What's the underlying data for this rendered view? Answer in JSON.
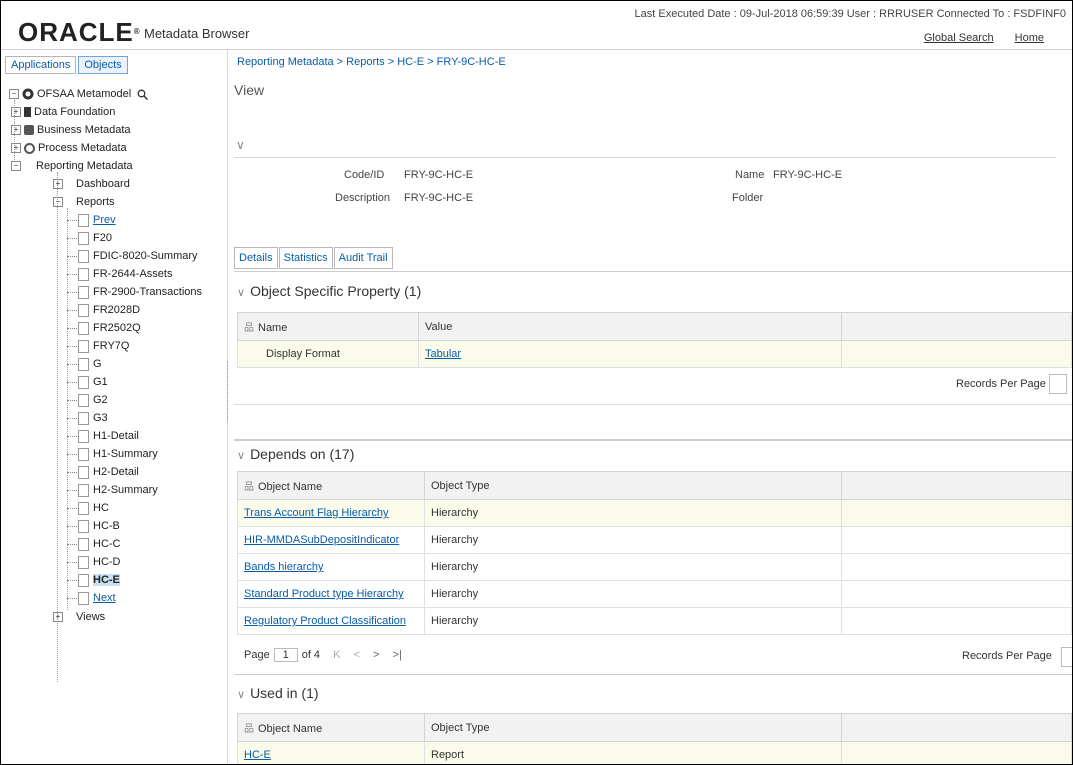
{
  "header": {
    "logo": "ORACLE",
    "app_title": "Metadata Browser",
    "info": "Last Executed Date : 09-Jul-2018 06:59:39   User : RRRUSER   Connected To : FSDFINF0",
    "links": [
      "Global Search",
      "Home"
    ]
  },
  "left_tabs": [
    "Applications",
    "Objects"
  ],
  "tree": {
    "root": "OFSAA Metamodel",
    "top_nodes": [
      "Data Foundation",
      "Business Metadata",
      "Process Metadata",
      "Reporting Metadata"
    ],
    "reporting_children": [
      "Dashboard",
      "Reports",
      "Views"
    ],
    "reports": [
      "Prev",
      "F20",
      "FDIC-8020-Summary",
      "FR-2644-Assets",
      "FR-2900-Transactions",
      "FR2028D",
      "FR2502Q",
      "FRY7Q",
      "G",
      "G1",
      "G2",
      "G3",
      "H1-Detail",
      "H1-Summary",
      "H2-Detail",
      "H2-Summary",
      "HC",
      "HC-B",
      "HC-C",
      "HC-D",
      "HC-E",
      "Next"
    ]
  },
  "breadcrumb": "Reporting Metadata > Reports > HC-E > FRY-9C-HC-E",
  "view_label": "View",
  "details": {
    "code_label": "Code/ID",
    "code_value": "FRY-9C-HC-E",
    "name_label": "Name",
    "name_value": "FRY-9C-HC-E",
    "desc_label": "Description",
    "desc_value": "FRY-9C-HC-E",
    "folder_label": "Folder"
  },
  "detail_tabs": [
    "Details",
    "Statistics",
    "Audit Trail"
  ],
  "osp": {
    "title": "Object Specific Property (1)",
    "cols": [
      "Name",
      "Value"
    ],
    "rows": [
      [
        "Display Format",
        "Tabular"
      ]
    ],
    "records_per_page": "Records Per Page"
  },
  "depends": {
    "title": "Depends on (17)",
    "cols": [
      "Object Name",
      "Object Type"
    ],
    "rows": [
      [
        "Trans Account Flag Hierarchy",
        "Hierarchy"
      ],
      [
        "HIR-MMDASubDepositIndicator",
        "Hierarchy"
      ],
      [
        "Bands hierarchy",
        "Hierarchy"
      ],
      [
        "Standard Product type Hierarchy",
        "Hierarchy"
      ],
      [
        "Regulatory Product Classification",
        "Hierarchy"
      ]
    ],
    "page_label": "Page",
    "page_value": "1",
    "of_label": "of 4",
    "records_per_page": "Records Per Page"
  },
  "used_in": {
    "title": "Used in (1)",
    "cols": [
      "Object Name",
      "Object Type"
    ],
    "rows": [
      [
        "HC-E",
        "Report"
      ]
    ]
  }
}
